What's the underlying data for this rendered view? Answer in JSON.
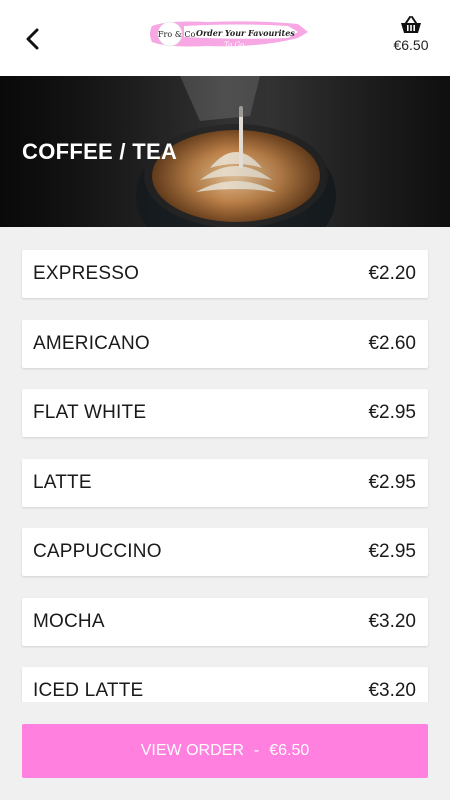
{
  "header": {
    "back_icon": "chevron-left-icon",
    "logo": {
      "left": "Fro & Co",
      "main": "Order Your Favourites",
      "sub": "To Go"
    },
    "cart_icon": "basket-icon",
    "cart_total": "€6.50"
  },
  "hero": {
    "title": "COFFEE / TEA"
  },
  "menu": {
    "items": [
      {
        "name": "EXPRESSO",
        "price": "€2.20"
      },
      {
        "name": "AMERICANO",
        "price": "€2.60"
      },
      {
        "name": "FLAT WHITE",
        "price": "€2.95"
      },
      {
        "name": "LATTE",
        "price": "€2.95"
      },
      {
        "name": "CAPPUCCINO",
        "price": "€2.95"
      },
      {
        "name": "MOCHA",
        "price": "€3.20"
      },
      {
        "name": "ICED LATTE",
        "price": "€3.20"
      }
    ]
  },
  "footer": {
    "button_label": "VIEW ORDER",
    "separator": "-",
    "button_total": "€6.50"
  },
  "colors": {
    "accent": "#ff80df",
    "background": "#f0f0f0",
    "text": "#1a1a1a"
  }
}
